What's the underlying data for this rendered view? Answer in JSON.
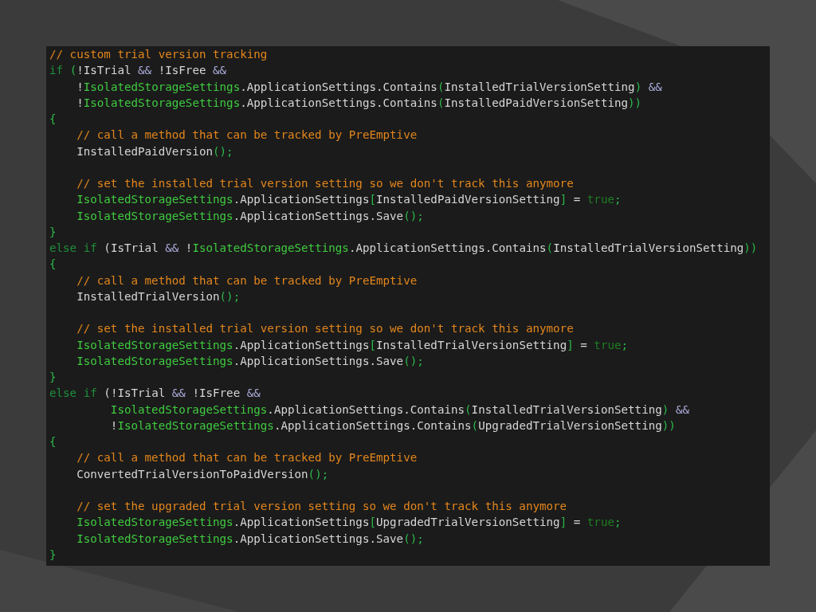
{
  "code_lines": [
    {
      "tokens": [
        {
          "kind": "comment",
          "text": "// custom trial version tracking"
        }
      ]
    },
    {
      "tokens": [
        {
          "kind": "keyword",
          "text": "if "
        },
        {
          "kind": "punct",
          "text": "("
        },
        {
          "kind": "plain",
          "text": "!IsTrial "
        },
        {
          "kind": "operator",
          "text": "&&"
        },
        {
          "kind": "plain",
          "text": " !IsFree "
        },
        {
          "kind": "operator",
          "text": "&&"
        }
      ]
    },
    {
      "tokens": [
        {
          "kind": "plain",
          "text": "    !"
        },
        {
          "kind": "type",
          "text": "IsolatedStorageSettings"
        },
        {
          "kind": "plain",
          "text": ".ApplicationSettings.Contains"
        },
        {
          "kind": "punct",
          "text": "("
        },
        {
          "kind": "plain",
          "text": "InstalledTrialVersionSetting"
        },
        {
          "kind": "punct",
          "text": ") "
        },
        {
          "kind": "operator",
          "text": "&&"
        }
      ]
    },
    {
      "tokens": [
        {
          "kind": "plain",
          "text": "    !"
        },
        {
          "kind": "type",
          "text": "IsolatedStorageSettings"
        },
        {
          "kind": "plain",
          "text": ".ApplicationSettings.Contains"
        },
        {
          "kind": "punct",
          "text": "("
        },
        {
          "kind": "plain",
          "text": "InstalledPaidVersionSetting"
        },
        {
          "kind": "punct",
          "text": "))"
        }
      ]
    },
    {
      "tokens": [
        {
          "kind": "punct",
          "text": "{"
        }
      ]
    },
    {
      "tokens": [
        {
          "kind": "comment",
          "text": "    // call a method that can be tracked by PreEmptive"
        }
      ]
    },
    {
      "tokens": [
        {
          "kind": "plain",
          "text": "    InstalledPaidVersion"
        },
        {
          "kind": "punct",
          "text": "();"
        }
      ]
    },
    {
      "gap_before": true,
      "tokens": [
        {
          "kind": "comment",
          "text": "    // set the installed trial version setting so we don't track this anymore"
        }
      ]
    },
    {
      "tokens": [
        {
          "kind": "type",
          "text": "    IsolatedStorageSettings"
        },
        {
          "kind": "plain",
          "text": ".ApplicationSettings"
        },
        {
          "kind": "punct",
          "text": "["
        },
        {
          "kind": "plain",
          "text": "InstalledPaidVersionSetting"
        },
        {
          "kind": "punct",
          "text": "]"
        },
        {
          "kind": "plain",
          "text": " = "
        },
        {
          "kind": "literal",
          "text": "true"
        },
        {
          "kind": "punct",
          "text": ";"
        }
      ]
    },
    {
      "tokens": [
        {
          "kind": "type",
          "text": "    IsolatedStorageSettings"
        },
        {
          "kind": "plain",
          "text": ".ApplicationSettings.Save"
        },
        {
          "kind": "punct",
          "text": "();"
        }
      ]
    },
    {
      "tokens": [
        {
          "kind": "punct",
          "text": "}"
        }
      ]
    },
    {
      "tokens": [
        {
          "kind": "keyword",
          "text": "else if"
        },
        {
          "kind": "plain",
          "text": " (IsTrial "
        },
        {
          "kind": "operator",
          "text": "&&"
        },
        {
          "kind": "plain",
          "text": " !"
        },
        {
          "kind": "type",
          "text": "IsolatedStorageSettings"
        },
        {
          "kind": "plain",
          "text": ".ApplicationSettings.Contains"
        },
        {
          "kind": "punct",
          "text": "("
        },
        {
          "kind": "plain",
          "text": "InstalledTrialVersionSetting"
        },
        {
          "kind": "punct",
          "text": "))"
        }
      ]
    },
    {
      "tokens": [
        {
          "kind": "punct",
          "text": "{"
        }
      ]
    },
    {
      "tokens": [
        {
          "kind": "comment",
          "text": "    // call a method that can be tracked by PreEmptive"
        }
      ]
    },
    {
      "tokens": [
        {
          "kind": "plain",
          "text": "    InstalledTrialVersion"
        },
        {
          "kind": "punct",
          "text": "();"
        }
      ]
    },
    {
      "gap_before": true,
      "tokens": [
        {
          "kind": "comment",
          "text": "    // set the installed trial version setting so we don't track this anymore"
        }
      ]
    },
    {
      "tokens": [
        {
          "kind": "type",
          "text": "    IsolatedStorageSettings"
        },
        {
          "kind": "plain",
          "text": ".ApplicationSettings"
        },
        {
          "kind": "punct",
          "text": "["
        },
        {
          "kind": "plain",
          "text": "InstalledTrialVersionSetting"
        },
        {
          "kind": "punct",
          "text": "]"
        },
        {
          "kind": "plain",
          "text": " = "
        },
        {
          "kind": "literal",
          "text": "true"
        },
        {
          "kind": "punct",
          "text": ";"
        }
      ]
    },
    {
      "tokens": [
        {
          "kind": "type",
          "text": "    IsolatedStorageSettings"
        },
        {
          "kind": "plain",
          "text": ".ApplicationSettings.Save"
        },
        {
          "kind": "punct",
          "text": "();"
        }
      ]
    },
    {
      "tokens": [
        {
          "kind": "punct",
          "text": "}"
        }
      ]
    },
    {
      "tokens": [
        {
          "kind": "keyword",
          "text": "else if"
        },
        {
          "kind": "plain",
          "text": " (!IsTrial "
        },
        {
          "kind": "operator",
          "text": "&&"
        },
        {
          "kind": "plain",
          "text": " !IsFree "
        },
        {
          "kind": "operator",
          "text": "&&"
        }
      ]
    },
    {
      "tokens": [
        {
          "kind": "type",
          "text": "         IsolatedStorageSettings"
        },
        {
          "kind": "plain",
          "text": ".ApplicationSettings.Contains"
        },
        {
          "kind": "punct",
          "text": "("
        },
        {
          "kind": "plain",
          "text": "InstalledTrialVersionSetting"
        },
        {
          "kind": "punct",
          "text": ") "
        },
        {
          "kind": "operator",
          "text": "&&"
        }
      ]
    },
    {
      "tokens": [
        {
          "kind": "plain",
          "text": "         !"
        },
        {
          "kind": "type",
          "text": "IsolatedStorageSettings"
        },
        {
          "kind": "plain",
          "text": ".ApplicationSettings.Contains"
        },
        {
          "kind": "punct",
          "text": "("
        },
        {
          "kind": "plain",
          "text": "UpgradedTrialVersionSetting"
        },
        {
          "kind": "punct",
          "text": "))"
        }
      ]
    },
    {
      "tokens": [
        {
          "kind": "punct",
          "text": "{"
        }
      ]
    },
    {
      "tokens": [
        {
          "kind": "comment",
          "text": "    // call a method that can be tracked by PreEmptive"
        }
      ]
    },
    {
      "tokens": [
        {
          "kind": "plain",
          "text": "    ConvertedTrialVersionToPaidVersion"
        },
        {
          "kind": "punct",
          "text": "();"
        }
      ]
    },
    {
      "gap_before": true,
      "tokens": [
        {
          "kind": "comment",
          "text": "    // set the upgraded trial version setting so we don't track this anymore"
        }
      ]
    },
    {
      "tokens": [
        {
          "kind": "type",
          "text": "    IsolatedStorageSettings"
        },
        {
          "kind": "plain",
          "text": ".ApplicationSettings"
        },
        {
          "kind": "punct",
          "text": "["
        },
        {
          "kind": "plain",
          "text": "UpgradedTrialVersionSetting"
        },
        {
          "kind": "punct",
          "text": "]"
        },
        {
          "kind": "plain",
          "text": " = "
        },
        {
          "kind": "literal",
          "text": "true"
        },
        {
          "kind": "punct",
          "text": ";"
        }
      ]
    },
    {
      "tokens": [
        {
          "kind": "type",
          "text": "    IsolatedStorageSettings"
        },
        {
          "kind": "plain",
          "text": ".ApplicationSettings.Save"
        },
        {
          "kind": "punct",
          "text": "();"
        }
      ]
    },
    {
      "tokens": [
        {
          "kind": "punct",
          "text": "}"
        }
      ]
    }
  ]
}
